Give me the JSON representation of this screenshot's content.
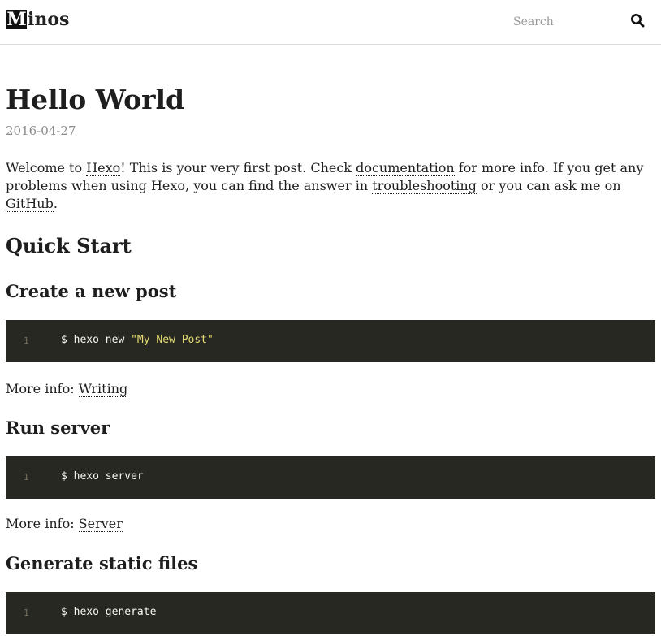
{
  "header": {
    "logo_letter": "M",
    "logo_rest": "inos",
    "search_placeholder": "Search",
    "search_icon": "search-icon"
  },
  "post": {
    "title": "Hello World",
    "date": "2016-04-27",
    "intro": {
      "t1": "Welcome to ",
      "link_hexo": "Hexo",
      "t2": "! This is your very first post. Check ",
      "link_docs": "documentation",
      "t3": " for more info. If you get any problems when using Hexo, you can find the answer in ",
      "link_troubleshooting": "troubleshooting",
      "t4": " or you can ask me on ",
      "link_github": "GitHub",
      "t5": "."
    },
    "quick_start": "Quick Start",
    "sections": [
      {
        "heading": "Create a new post",
        "line_number": "1",
        "command": "$ hexo new ",
        "string": "\"My New Post\"",
        "more_label": "More info: ",
        "more_link": "Writing"
      },
      {
        "heading": "Run server",
        "line_number": "1",
        "command": "$ hexo server",
        "more_label": "More info: ",
        "more_link": "Server"
      },
      {
        "heading": "Generate static files",
        "line_number": "1",
        "command": "$ hexo generate"
      }
    ]
  },
  "colors": {
    "code_bg": "#272822",
    "code_string": "#e6db74",
    "code_text": "#f8f8f2"
  }
}
